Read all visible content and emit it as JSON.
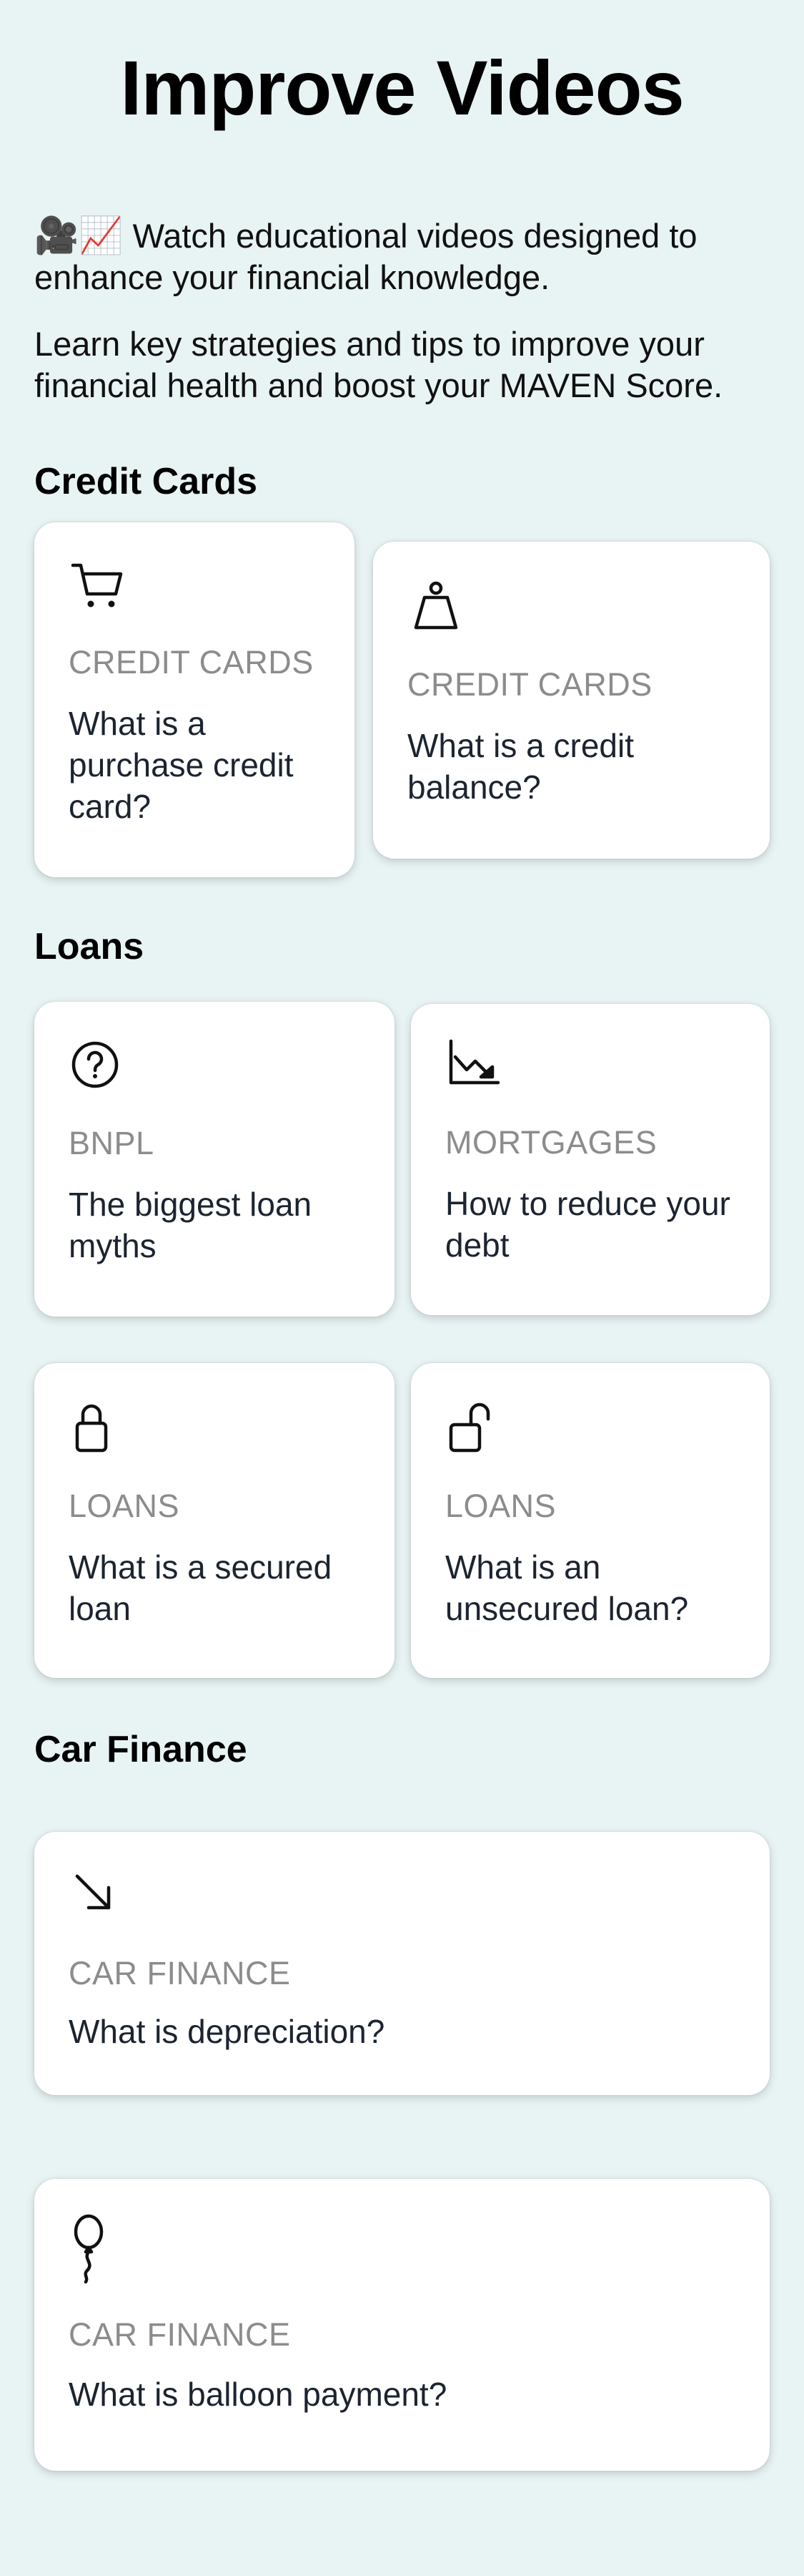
{
  "page": {
    "title": "Improve Videos",
    "intro_emoji": "🎥📈",
    "intro_line1": "Watch educational videos designed to enhance your financial knowledge.",
    "intro_line2": "Learn key strategies and tips to improve your financial health and boost your MAVEN Score."
  },
  "sections": [
    {
      "title": "Credit Cards",
      "cards": [
        {
          "icon": "shopping-cart-icon",
          "category": "CREDIT CARDS",
          "question": "What is a purchase credit card?"
        },
        {
          "icon": "weight-icon",
          "category": "CREDIT CARDS",
          "question": "What is a credit balance?"
        }
      ]
    },
    {
      "title": "Loans",
      "cards": [
        {
          "icon": "question-circle-icon",
          "category": "BNPL",
          "question": "The biggest loan myths"
        },
        {
          "icon": "chart-down-icon",
          "category": "MORTGAGES",
          "question": "How to reduce your debt"
        },
        {
          "icon": "lock-icon",
          "category": "LOANS",
          "question": "What is a secured loan"
        },
        {
          "icon": "unlock-icon",
          "category": "LOANS",
          "question": "What is an unsecured loan?"
        }
      ]
    },
    {
      "title": "Car Finance",
      "cards": [
        {
          "icon": "arrow-down-right-icon",
          "category": "CAR FINANCE",
          "question": "What is depreciation?"
        },
        {
          "icon": "balloon-icon",
          "category": "CAR FINANCE",
          "question": "What is balloon payment?"
        }
      ]
    }
  ]
}
